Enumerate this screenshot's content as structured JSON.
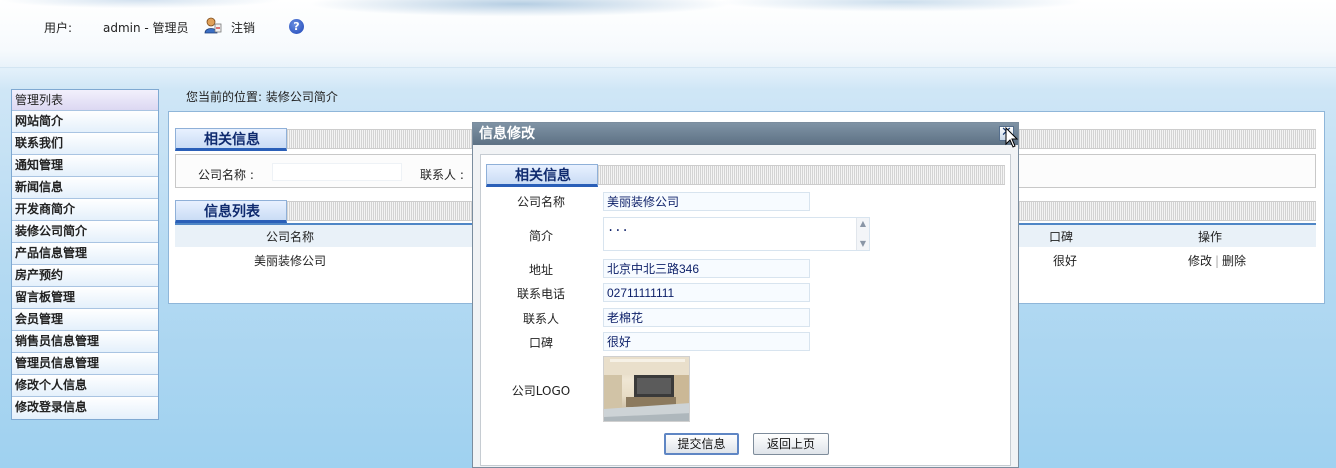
{
  "header": {
    "user_label": "用户:",
    "user_value": "admin - 管理员",
    "logout_label": "注销",
    "help_icon": "?"
  },
  "sidebar": {
    "title": "管理列表",
    "items": [
      {
        "label": "网站简介"
      },
      {
        "label": "联系我们"
      },
      {
        "label": "通知管理"
      },
      {
        "label": "新闻信息"
      },
      {
        "label": "开发商简介"
      },
      {
        "label": "装修公司简介"
      },
      {
        "label": "产品信息管理"
      },
      {
        "label": "房产预约"
      },
      {
        "label": "留言板管理"
      },
      {
        "label": "会员管理"
      },
      {
        "label": "销售员信息管理"
      },
      {
        "label": "管理员信息管理"
      },
      {
        "label": "修改个人信息"
      },
      {
        "label": "修改登录信息"
      }
    ]
  },
  "breadcrumb": "您当前的位置: 装修公司简介",
  "main": {
    "section_related": "相关信息",
    "section_list": "信息列表",
    "search": {
      "company_label": "公司名称 :",
      "contact_label": "联系人 :",
      "company_value": "",
      "contact_value": ""
    },
    "table": {
      "columns": [
        "公司名称",
        "口碑",
        "操作"
      ],
      "rows": [
        {
          "company": "美丽装修公司",
          "reputation": "很好",
          "edit": "修改",
          "delete": "删除"
        }
      ]
    }
  },
  "modal": {
    "title": "信息修改",
    "close_icon": "✕",
    "section_title": "相关信息",
    "fields": {
      "company": {
        "label": "公司名称",
        "value": "美丽装修公司"
      },
      "intro": {
        "label": "简介",
        "value": "..."
      },
      "address": {
        "label": "地址",
        "value": "北京中北三路346"
      },
      "phone": {
        "label": "联系电话",
        "value": "02711111111"
      },
      "contact": {
        "label": "联系人",
        "value": "老棉花"
      },
      "reputation": {
        "label": "口碑",
        "value": "很好"
      },
      "logo": {
        "label": "公司LOGO"
      }
    },
    "submit_label": "提交信息",
    "back_label": "返回上页"
  }
}
